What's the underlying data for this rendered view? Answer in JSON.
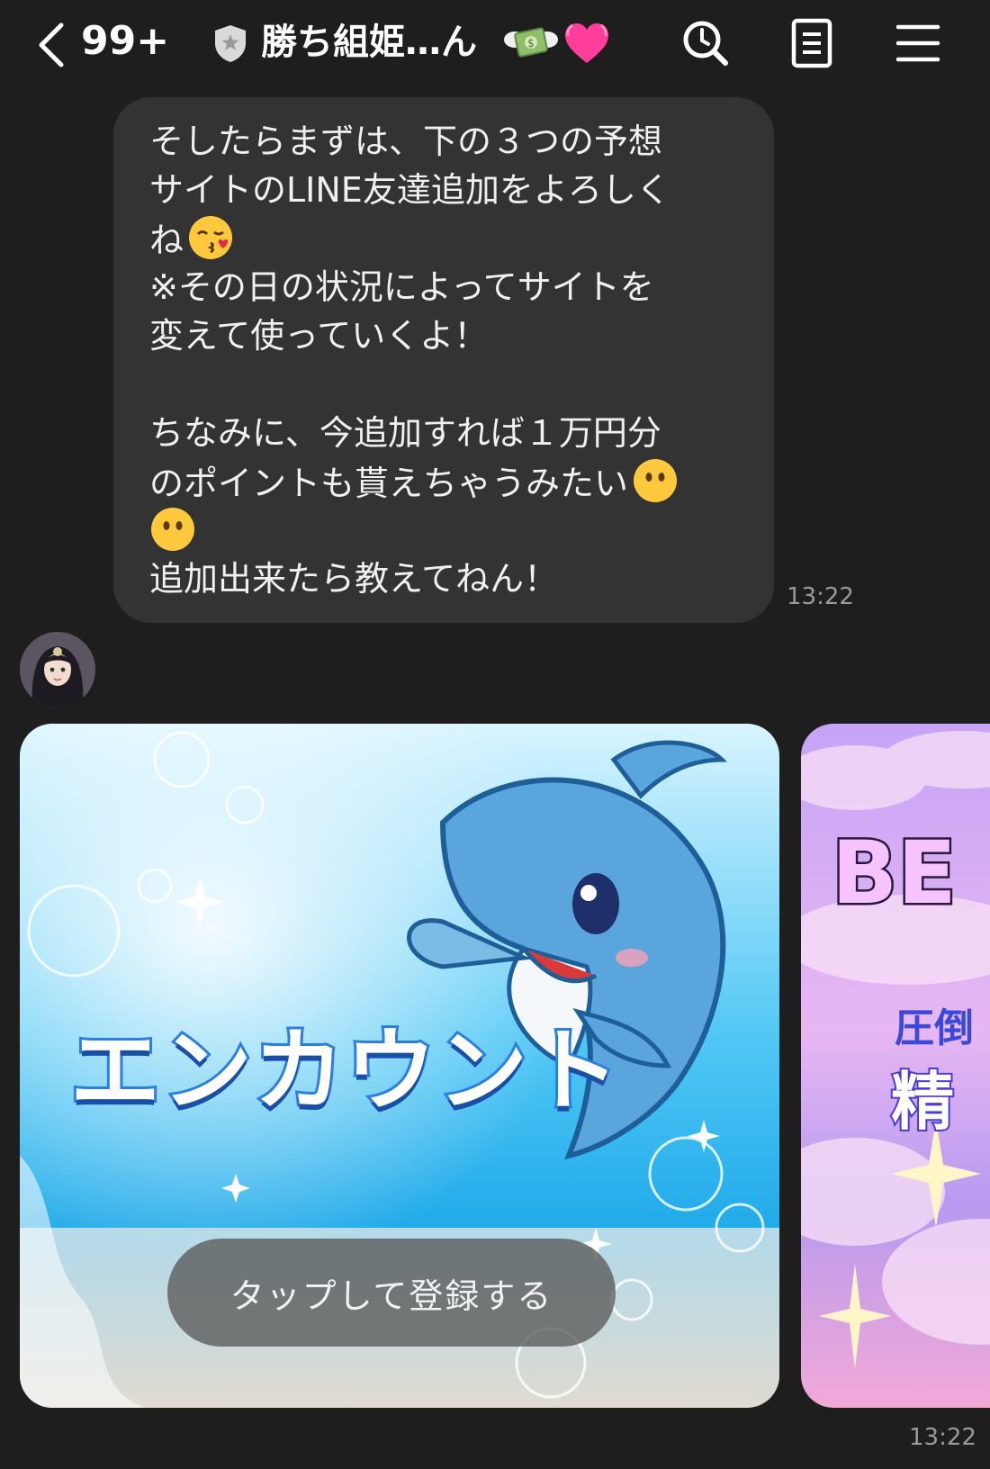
{
  "header": {
    "unread_count": "99+",
    "chat_title": "勝ち組姫…ん",
    "icons": [
      "chevron-left-icon",
      "shield-icon",
      "money-wings-emoji",
      "heart-emoji",
      "search-icon",
      "notes-icon",
      "menu-icon"
    ]
  },
  "message": {
    "lines": [
      "そしたらまずは、下の３つの予想",
      "サイトのLINE友達追加をよろしく",
      "ね",
      "※その日の状況によってサイトを",
      "変えて使っていくよ！",
      "",
      "ちなみに、今追加すれば１万円分",
      "のポイントも貰えちゃうみたい",
      "",
      "追加出来たら教えてねん！"
    ],
    "time": "13:22"
  },
  "cards": [
    {
      "title": "エンカウント",
      "button_label": "タップして登録する"
    },
    {
      "title": "BE",
      "subtitle1": "圧倒",
      "subtitle2": "精"
    }
  ],
  "cards_time": "13:22",
  "colors": {
    "background": "#1e1e1e",
    "bubble": "#333333",
    "timestamp": "#9a9a9a"
  }
}
